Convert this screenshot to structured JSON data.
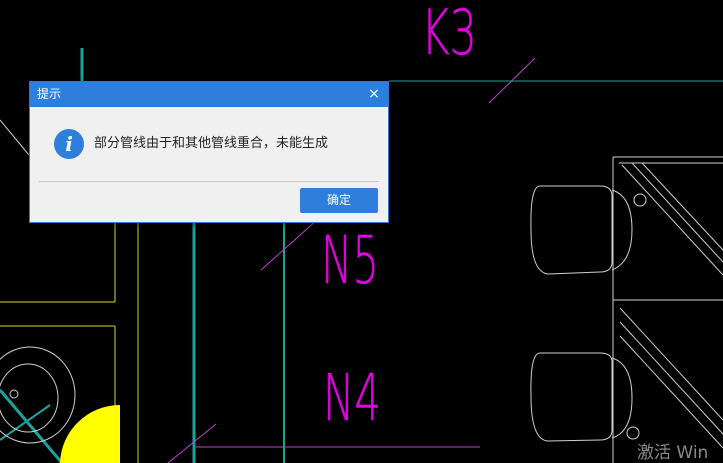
{
  "cad": {
    "labels": [
      "K3",
      "N5",
      "N4"
    ],
    "colors": {
      "background": "#000000",
      "label": "#e000e0",
      "pipe": "#1aa39a",
      "wall": "#d9d92a",
      "furniture": "#d0d0d0",
      "fill": "#ffff00",
      "lead": "#c040d0"
    }
  },
  "dialog": {
    "title": "提示",
    "close_glyph": "×",
    "icon": "info-icon",
    "icon_glyph": "i",
    "message": "部分管线由于和其他管线重合，未能生成",
    "ok_label": "确定"
  },
  "watermark": "激活 Win"
}
